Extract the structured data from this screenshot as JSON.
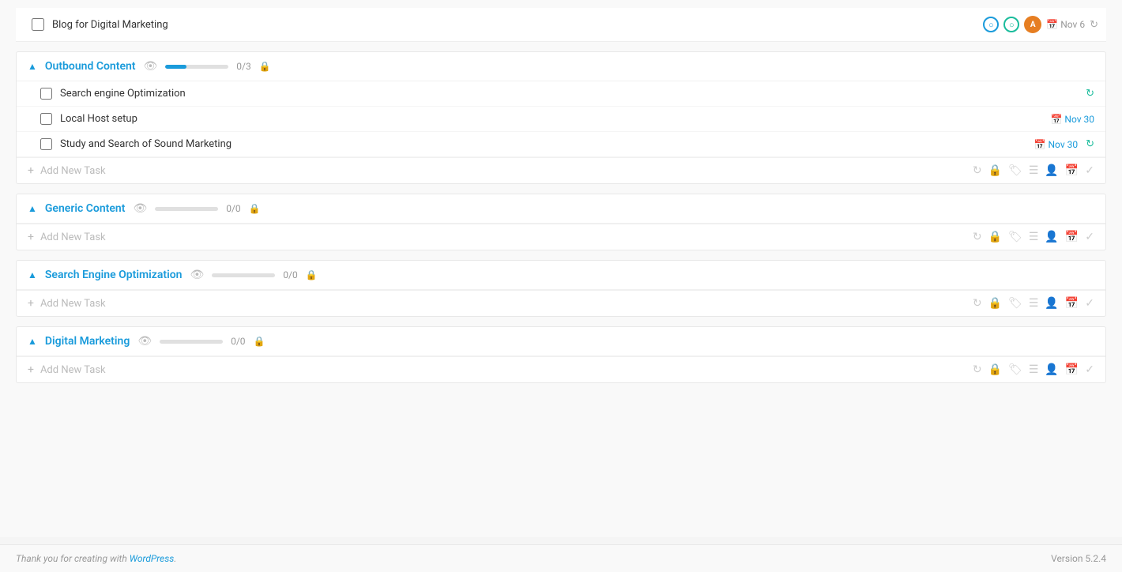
{
  "top_task": {
    "name": "Blog for Digital Marketing",
    "date": "Nov 6",
    "icons": {
      "circle1": "○",
      "circle2": "○"
    }
  },
  "sections": [
    {
      "id": "outbound-content",
      "title": "Outbound Content",
      "progress_current": 0,
      "progress_total": 3,
      "progress_width": "33",
      "tasks": [
        {
          "name": "Search engine Optimization",
          "has_refresh": true,
          "date": null
        },
        {
          "name": "Local Host setup",
          "has_refresh": false,
          "date": "Nov 30"
        },
        {
          "name": "Study and Search of Sound Marketing",
          "has_refresh": true,
          "date": "Nov 30"
        }
      ],
      "add_label": "Add New Task"
    },
    {
      "id": "generic-content",
      "title": "Generic Content",
      "progress_current": 0,
      "progress_total": 0,
      "progress_width": "0",
      "tasks": [],
      "add_label": "Add New Task"
    },
    {
      "id": "search-engine-optimization",
      "title": "Search Engine Optimization",
      "progress_current": 0,
      "progress_total": 0,
      "progress_width": "0",
      "tasks": [],
      "add_label": "Add New Task"
    },
    {
      "id": "digital-marketing",
      "title": "Digital Marketing",
      "progress_current": 0,
      "progress_total": 0,
      "progress_width": "0",
      "tasks": [],
      "add_label": "Add New Task"
    }
  ],
  "footer": {
    "left_text": "Thank you for creating with WordPress.",
    "link_text": "WordPress",
    "right_text": "Version 5.2.4"
  },
  "action_icons": {
    "refresh": "↻",
    "lock": "🔒",
    "tag": "🏷",
    "list": "☰",
    "person": "👤",
    "calendar": "📅",
    "check": "✓"
  }
}
